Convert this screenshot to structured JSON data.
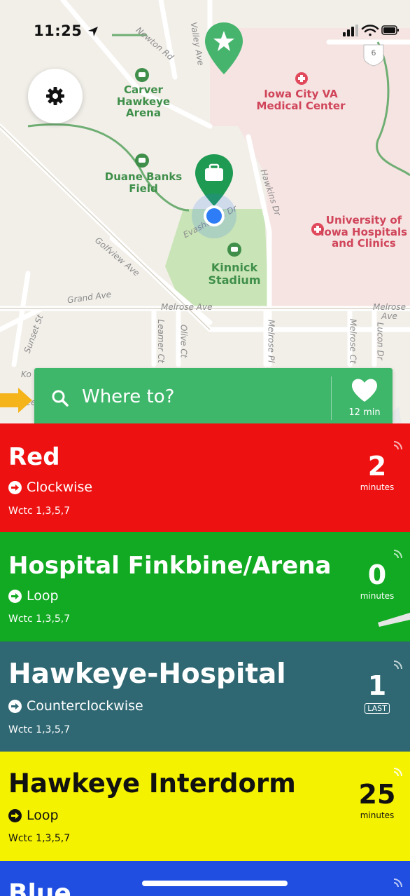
{
  "status_bar": {
    "time": "11:25"
  },
  "map": {
    "places": [
      {
        "name": "Carver\nHawkeye Arena",
        "type": "venue"
      },
      {
        "name": "Iowa City VA\nMedical Center",
        "type": "hospital"
      },
      {
        "name": "Duane Banks\nField",
        "type": "venue"
      },
      {
        "name": "University of\nIowa Hospitals\nand Clinics",
        "type": "hospital"
      },
      {
        "name": "Kinnick Stadium",
        "type": "stadium"
      }
    ],
    "streets": [
      "Newton Rd",
      "Valley Ave",
      "Hawkins Dr",
      "Evashevski Dr",
      "Golfview Ave",
      "Grand Ave",
      "Melrose Ave",
      "Melrose Ave",
      "Sunset St",
      "Leamer Ct",
      "Olive Ct",
      "Melrose Pl",
      "Melrose Ct",
      "Lucon Dr",
      "Ko",
      "Lee"
    ],
    "highway_shield": "6"
  },
  "search": {
    "placeholder": "Where to?",
    "favorite_time": "12 min"
  },
  "colors": {
    "search_green": "#3fb76b",
    "route_red": "#ee1111",
    "route_green": "#11aa22",
    "route_teal": "#2f6873",
    "route_yellow": "#f5f200",
    "route_blue": "#1f4ee0"
  },
  "routes": [
    {
      "name": "Red",
      "direction": "Clockwise",
      "stops": "Wctc 1,3,5,7",
      "eta": "2",
      "eta_unit": "minutes"
    },
    {
      "name": "Hospital Finkbine/Arena",
      "direction": "Loop",
      "stops": "Wctc 1,3,5,7",
      "eta": "0",
      "eta_unit": "minutes"
    },
    {
      "name": "Hawkeye-Hospital",
      "direction": "Counterclockwise",
      "stops": "Wctc 1,3,5,7",
      "eta": "1",
      "eta_unit": "LAST"
    },
    {
      "name": "Hawkeye Interdorm",
      "direction": "Loop",
      "stops": "Wctc 1,3,5,7",
      "eta": "25",
      "eta_unit": "minutes"
    },
    {
      "name": "Blue",
      "direction": "",
      "stops": "",
      "eta": "",
      "eta_unit": ""
    }
  ],
  "icons": {
    "settings": "gear-icon",
    "search": "search-icon",
    "favorite": "heart-icon",
    "location": "location-arrow-icon",
    "direction": "arrow-right-circle-icon",
    "realtime": "signal-icon"
  }
}
